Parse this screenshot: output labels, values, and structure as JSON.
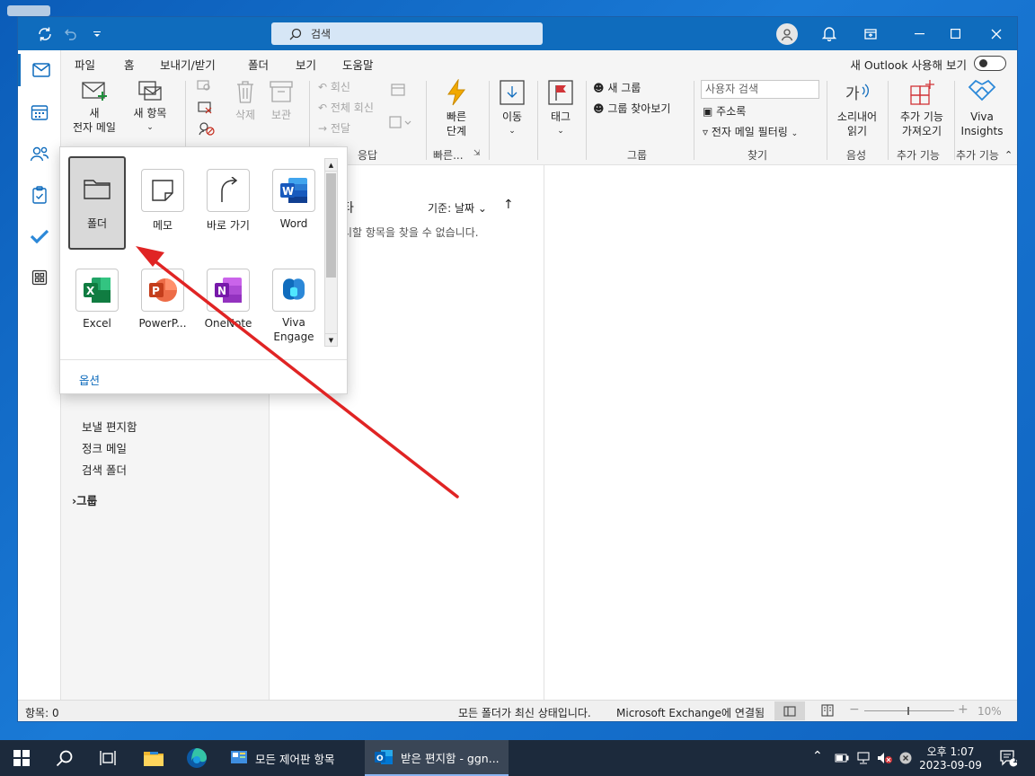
{
  "title": {
    "search_placeholder": "검색"
  },
  "menu": {
    "tabs": [
      "파일",
      "홈",
      "보내기/받기",
      "폴더",
      "보기",
      "도움말"
    ],
    "selected": "홈",
    "new_outlook_label": "새 Outlook 사용해 보기"
  },
  "ribbon": {
    "new_mail": "새\n전자 메일",
    "new_items": "새 항목",
    "delete": "삭제",
    "archive": "보관",
    "reply": "회신",
    "reply_all": "전체 회신",
    "forward": "전달",
    "group_respond_partial": "응답",
    "quick_steps": "빠른\n단계",
    "group_quick_partial": "빠른...",
    "move": "이동",
    "tags": "태그",
    "new_group": "새 그룹",
    "browse_groups": "그룹 찾아보기",
    "group_groups": "그룹",
    "search_people_placeholder": "사용자 검색",
    "address_book": "주소록",
    "filter_email": "전자 메일 필터링",
    "group_find": "찾기",
    "read_aloud": "소리내어\n읽기",
    "group_speech": "음성",
    "get_addins": "추가 기능\n가져오기",
    "group_addins": "추가 기능",
    "viva_insights": "Viva\nInsights",
    "group_addins2": "추가 기능"
  },
  "folder_pane": {
    "items": [
      "보낼 편지함",
      "정크 메일",
      "검색 폴더"
    ],
    "groups": "그룹"
  },
  "list_pane": {
    "heading_partial": "타",
    "sort_label": "기준: 날짜",
    "empty_message_partial": "시할 항목을 찾을 수 없습니다."
  },
  "app_launcher": {
    "apps": [
      {
        "label": "폴더",
        "icon": "folder-icon"
      },
      {
        "label": "메모",
        "icon": "note-icon"
      },
      {
        "label": "바로 가기",
        "icon": "shortcut-arrow-icon"
      },
      {
        "label": "Word",
        "icon": "word-icon"
      },
      {
        "label": "Excel",
        "icon": "excel-icon"
      },
      {
        "label": "PowerP...",
        "icon": "powerpoint-icon"
      },
      {
        "label": "OneNote",
        "icon": "onenote-icon"
      },
      {
        "label": "Viva\nEngage",
        "icon": "viva-engage-icon"
      }
    ],
    "selected": "폴더",
    "options": "옵션"
  },
  "status": {
    "items_count": "항목: 0",
    "sync_status": "모든 폴더가 최신 상태입니다.",
    "connection": "Microsoft Exchange에 연결됨",
    "zoom": "10%"
  },
  "taskbar": {
    "task1": "모든 제어판 항목",
    "task2": "받은 편지함 - ggn...",
    "time": "오후 1:07",
    "date": "2023-09-09",
    "notification_count": "1"
  },
  "colors": {
    "accent": "#0f6cbd",
    "annotation_arrow": "#e02424"
  }
}
